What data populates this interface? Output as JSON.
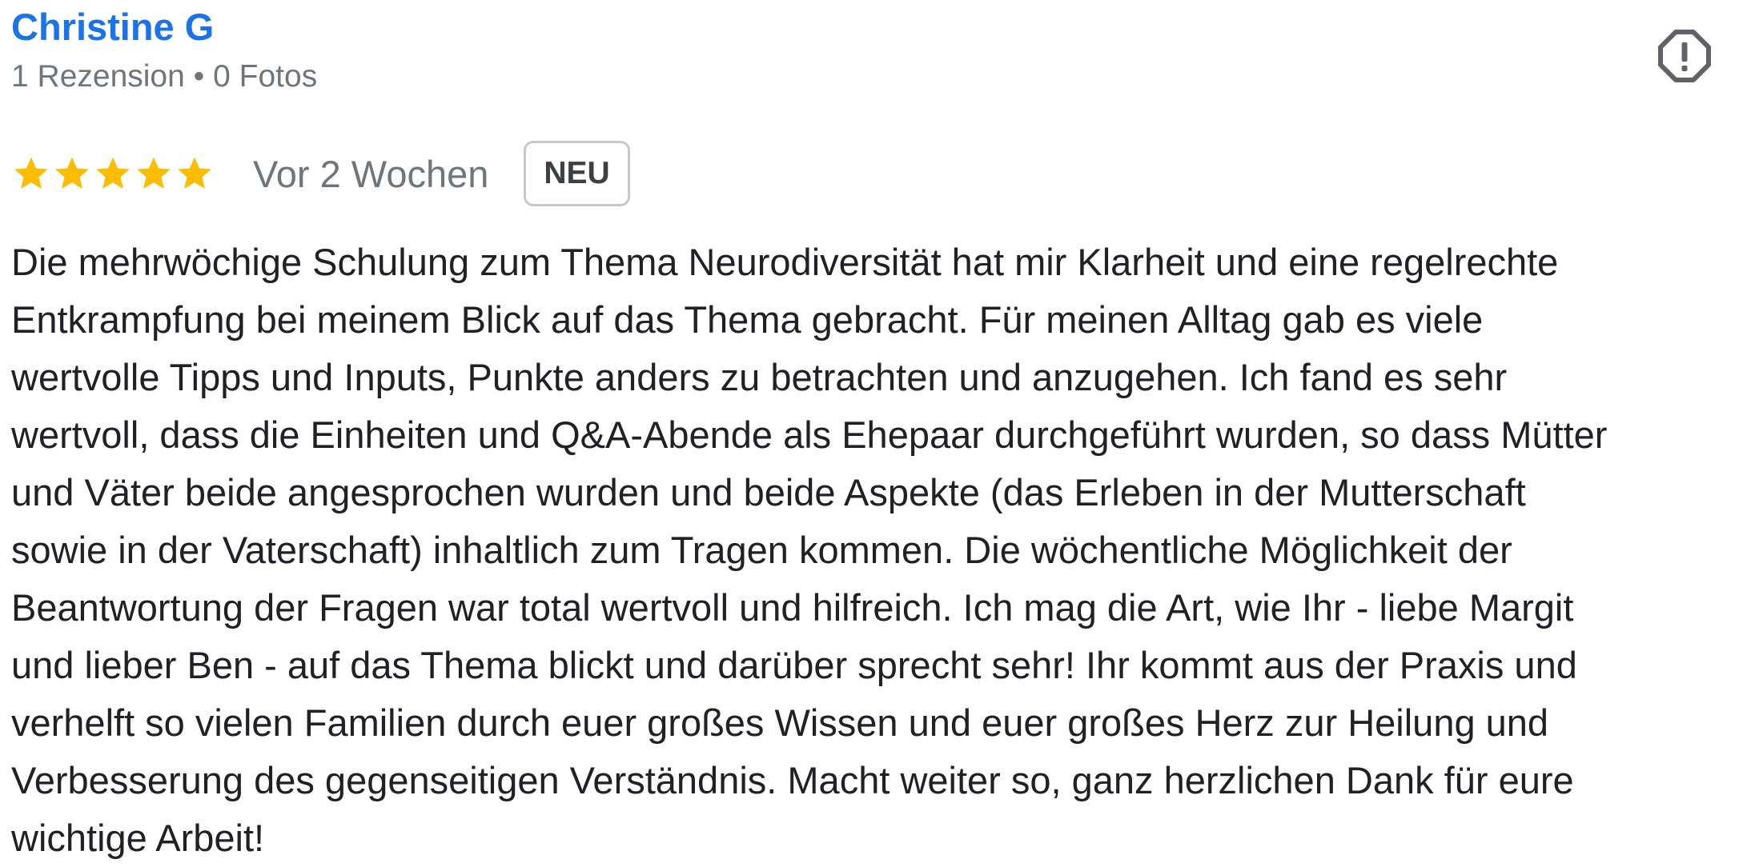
{
  "reviewer": {
    "name": "Christine G",
    "meta": "1 Rezension • 0 Fotos"
  },
  "actions": {
    "report_icon": "report-flag-octagon-icon"
  },
  "rating": {
    "stars": 5,
    "max_stars": 5,
    "star_color": "#fbbc04"
  },
  "review": {
    "date": "Vor 2 Wochen",
    "badge": "NEU",
    "text": "Die mehrwöchige Schulung zum Thema Neurodiversität hat mir Klarheit und eine regelrechte\nEntkrampfung bei meinem Blick auf das Thema gebracht. Für meinen Alltag gab es viele\nwertvolle Tipps und Inputs, Punkte anders zu betrachten und anzugehen. Ich fand es sehr\nwertvoll, dass die Einheiten und Q&A-Abende als Ehepaar durchgeführt wurden, so dass Mütter\nund Väter beide angesprochen wurden und beide Aspekte (das Erleben in der Mutterschaft\nsowie in der Vaterschaft) inhaltlich zum Tragen kommen. Die wöchentliche Möglichkeit der\nBeantwortung der Fragen war total wertvoll und hilfreich. Ich mag die Art, wie Ihr - liebe Margit\nund lieber Ben - auf das Thema blickt und darüber sprecht sehr! Ihr kommt aus der Praxis und\nverhelft so vielen Familien durch euer großes Wissen und euer großes Herz zur Heilung und\nVerbesserung des gegenseitigen Verständnis. Macht weiter so, ganz herzlichen Dank für eure\nwichtige Arbeit!"
  },
  "colors": {
    "name": "#1a73e8",
    "meta": "#70757a",
    "body_text": "#202124",
    "icon": "#5f6368",
    "badge_border": "#c8c8c8"
  }
}
